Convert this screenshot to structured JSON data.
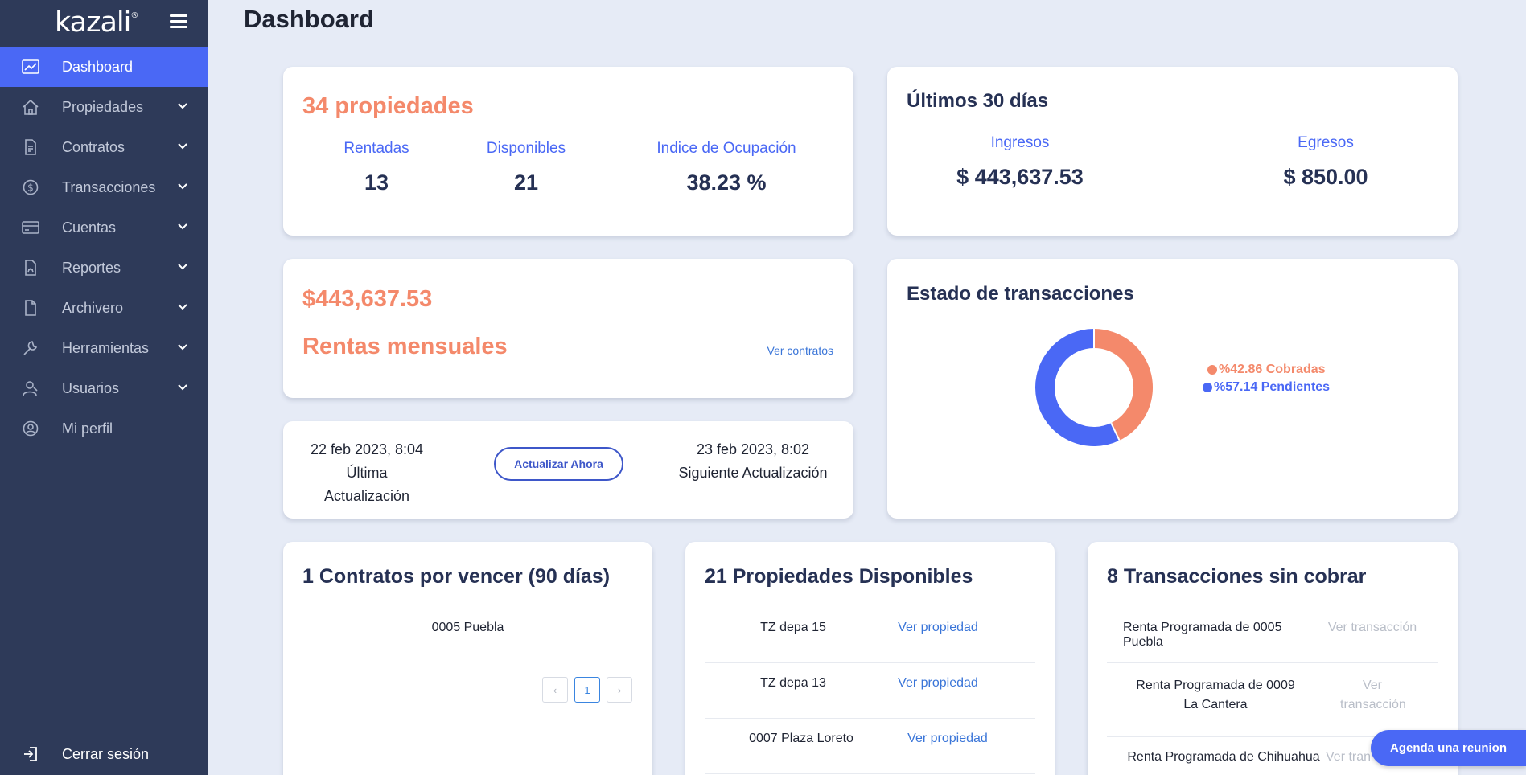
{
  "sidebar": {
    "logo": "kazali",
    "logo_mark": "®",
    "items": [
      {
        "label": "Dashboard",
        "icon": "chart-line-icon",
        "active": true
      },
      {
        "label": "Propiedades",
        "icon": "home-icon"
      },
      {
        "label": "Contratos",
        "icon": "document-icon"
      },
      {
        "label": "Transacciones",
        "icon": "dollar-circle-icon"
      },
      {
        "label": "Cuentas",
        "icon": "credit-card-icon"
      },
      {
        "label": "Reportes",
        "icon": "pdf-file-icon"
      },
      {
        "label": "Archivero",
        "icon": "file-icon"
      },
      {
        "label": "Herramientas",
        "icon": "wrench-icon"
      },
      {
        "label": "Usuarios",
        "icon": "users-icon"
      },
      {
        "label": "Mi perfil",
        "icon": "user-circle-icon"
      }
    ],
    "logout": "Cerrar sesión"
  },
  "page": {
    "title": "Dashboard"
  },
  "properties_card": {
    "headline": "34 propiedades",
    "stats": [
      {
        "label": "Rentadas",
        "value": "13"
      },
      {
        "label": "Disponibles",
        "value": "21"
      },
      {
        "label": "Indice de Ocupación",
        "value": "38.23 %"
      }
    ]
  },
  "last30": {
    "title": "Últimos 30 días",
    "ingresos_label": "Ingresos",
    "ingresos_value": "$ 443,637.53",
    "egresos_label": "Egresos",
    "egresos_value": "$ 850.00"
  },
  "rentas": {
    "amount": "$443,637.53",
    "label": "Rentas mensuales",
    "link": "Ver contratos"
  },
  "update": {
    "last_date": "22 feb 2023, 8:04",
    "last_label": "Última Actualización",
    "button": "Actualizar Ahora",
    "next_date": "23 feb 2023, 8:02",
    "next_label": "Siguiente Actualización"
  },
  "transactions_status": {
    "title": "Estado de transacciones",
    "cobradas_label": "%42.86 Cobradas",
    "pendientes_label": "%57.14 Pendientes",
    "cobradas_pct": 42.86,
    "pendientes_pct": 57.14,
    "colors": {
      "cobradas": "#f4896b",
      "pendientes": "#4a68f5"
    }
  },
  "contracts": {
    "title": "1 Contratos por vencer (90 días)",
    "rows": [
      "0005 Puebla"
    ],
    "pager": {
      "prev": "‹",
      "page": "1",
      "next": "›"
    }
  },
  "available": {
    "title": "21 Propiedades Disponibles",
    "link_label": "Ver propiedad",
    "rows": [
      "TZ depa 15",
      "TZ depa 13",
      "0007 Plaza Loreto"
    ]
  },
  "uncollected": {
    "title": "8 Transacciones sin cobrar",
    "link_label": "Ver transacción",
    "link_label_wrapped_1": "Ver",
    "link_label_wrapped_2": "transacción",
    "link_label_cut": "Ver tran",
    "rows": [
      "Renta Programada de 0005 Puebla",
      "Renta Programada de 0009 La Cantera",
      "Renta Programada de Chihuahua"
    ]
  },
  "fab": {
    "label": "Agenda una reunion"
  }
}
